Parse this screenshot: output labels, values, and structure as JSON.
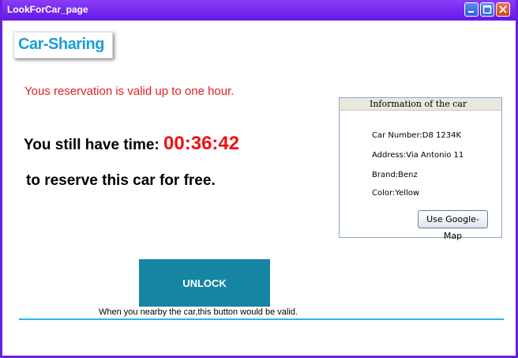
{
  "window": {
    "title": "LookForCar_page",
    "controls": {
      "minimize_icon": "minimize-icon",
      "maximize_icon": "maximize-icon",
      "close_icon": "close-icon"
    }
  },
  "logo": {
    "text": "Car-Sharing"
  },
  "reservation": {
    "notice": "Yous reservation is valid up to one hour.",
    "time_prefix": "You still have time: ",
    "timer": "00:36:42",
    "free_text": "to reserve this car for free",
    "free_suffix": "."
  },
  "car_info": {
    "title": "Information of the car",
    "car_number": "Car Number:D8 1234K",
    "address": "Address:Via Antonio 11",
    "brand": "Brand:Benz",
    "color": "Color:Yellow",
    "map_button": "Use Google-Map"
  },
  "unlock": {
    "button_label": "UNLOCK",
    "hint": "When you nearby the car,this button would be valid."
  },
  "colors": {
    "titlebar": "#6a1fe0",
    "accent": "#1a9fd6",
    "notice": "#e02020",
    "timer": "#f01010",
    "unlock_button": "#1685a3",
    "divider": "#26b8e8"
  }
}
